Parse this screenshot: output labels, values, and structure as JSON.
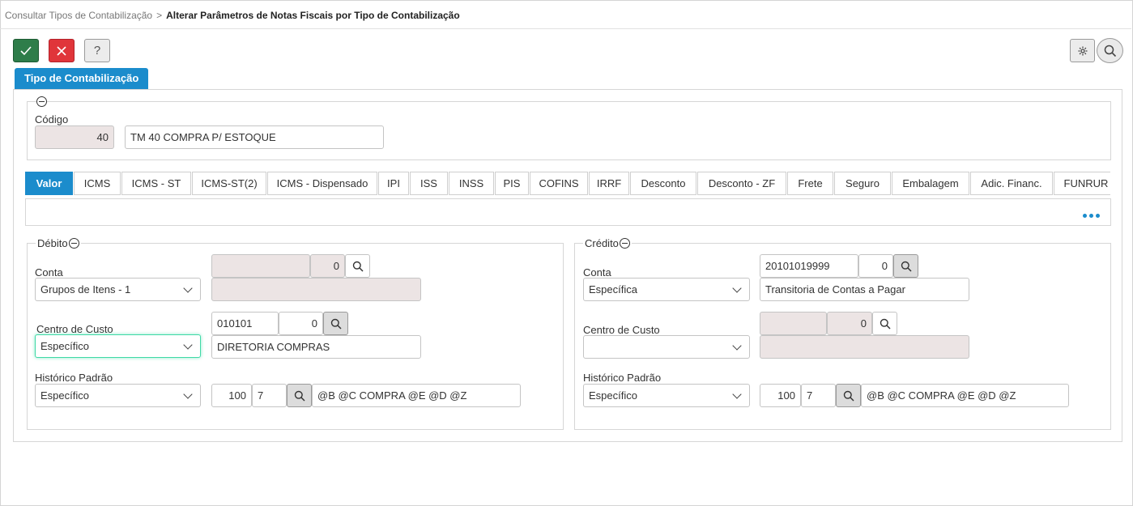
{
  "breadcrumb": {
    "parent": "Consultar Tipos de Contabilização",
    "separator": ">",
    "current": "Alterar Parâmetros de Notas Fiscais por Tipo de Contabilização"
  },
  "toolbar": {
    "help_label": "?",
    "colors": {
      "confirm": "#2e7d4a",
      "cancel": "#e0353a"
    },
    "icons": [
      "check-icon",
      "close-icon",
      "help-icon",
      "gear-icon",
      "search-icon"
    ]
  },
  "section_tab": "Tipo de Contabilização",
  "header": {
    "codigo_label": "Código",
    "codigo_value": "40",
    "descricao_value": "TM 40 COMPRA P/ ESTOQUE"
  },
  "tabs": [
    "Valor",
    "ICMS",
    "ICMS - ST",
    "ICMS-ST(2)",
    "ICMS - Dispensado",
    "IPI",
    "ISS",
    "INSS",
    "PIS",
    "COFINS",
    "IRRF",
    "Desconto",
    "Desconto - ZF",
    "Frete",
    "Seguro",
    "Embalagem",
    "Adic. Financ.",
    "FUNRUR"
  ],
  "active_tab": "Valor",
  "debito": {
    "legend": "Débito",
    "conta_label": "Conta",
    "conta_tipo": "Grupos de Itens - 1",
    "conta_codigo": "",
    "conta_digito": "0",
    "conta_descricao": "",
    "cc_label": "Centro de Custo",
    "cc_tipo": "Específico",
    "cc_codigo": "010101",
    "cc_digito": "0",
    "cc_descricao": "DIRETORIA COMPRAS",
    "hist_label": "Histórico Padrão",
    "hist_tipo": "Específico",
    "hist_codigo": "100",
    "hist_digito": "7",
    "hist_texto": "@B @C COMPRA @E @D @Z"
  },
  "credito": {
    "legend": "Crédito",
    "conta_label": "Conta",
    "conta_tipo": "Específica",
    "conta_codigo": "20101019999",
    "conta_digito": "0",
    "conta_descricao": "Transitoria de Contas a Pagar",
    "cc_label": "Centro de Custo",
    "cc_tipo": "",
    "cc_codigo": "",
    "cc_digito": "0",
    "cc_descricao": "",
    "hist_label": "Histórico Padrão",
    "hist_tipo": "Específico",
    "hist_codigo": "100",
    "hist_digito": "7",
    "hist_texto": "@B @C COMPRA @E @D @Z"
  }
}
